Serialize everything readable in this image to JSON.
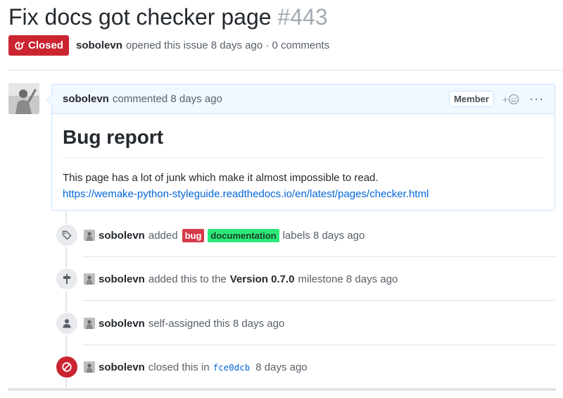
{
  "issue": {
    "title": "Fix docs got checker page",
    "number": "#443",
    "state_label": "Closed",
    "author": "sobolevn",
    "meta_text": "opened this issue 8 days ago · 0 comments"
  },
  "comment": {
    "author": "sobolevn",
    "time_text": "commented 8 days ago",
    "member_badge": "Member",
    "reaction_plus": "+",
    "more_label": "···",
    "heading": "Bug report",
    "body": "This page has a lot of junk which make it almost impossible to read.",
    "link": "https://wemake-python-styleguide.readthedocs.io/en/latest/pages/checker.html"
  },
  "events": {
    "labels": {
      "author": "sobolevn",
      "action": "added",
      "label_1": "bug",
      "label_2": "documentation",
      "suffix": "labels 8 days ago"
    },
    "milestone": {
      "author": "sobolevn",
      "action": "added this to the",
      "milestone_name": "Version 0.7.0",
      "suffix": "milestone 8 days ago"
    },
    "assigned": {
      "author": "sobolevn",
      "action": "self-assigned this 8 days ago"
    },
    "closed": {
      "author": "sobolevn",
      "action": "closed this in",
      "commit": "fce0dcb",
      "suffix": "8 days ago"
    }
  },
  "colors": {
    "closed_red": "#cb2431",
    "link_blue": "#0366d6",
    "bug_label": "#d73a4a",
    "documentation_label": "#2cea7a"
  },
  "icons": {
    "state": "issue-closed-icon",
    "reaction": "smiley-icon",
    "labels_event": "tag-icon",
    "milestone_event": "milestone-icon",
    "assigned_event": "person-icon",
    "closed_event": "circle-slash-icon"
  }
}
